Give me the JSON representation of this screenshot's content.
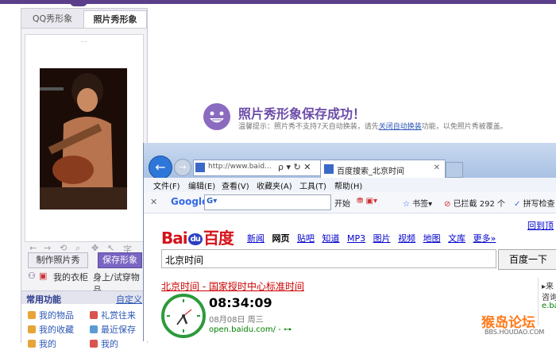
{
  "left_panel": {
    "tabs": [
      "QQ秀形象",
      "照片秀形象"
    ],
    "photo_label": "...",
    "make_button": "制作照片秀",
    "save_button": "保存形象",
    "links": [
      "我的衣柜",
      "身上/试穿物品"
    ],
    "section_title": "常用功能",
    "section_custom": "自定义",
    "functions": [
      "我的物品",
      "礼赏往来",
      "我的收藏",
      "最近保存",
      "我的",
      "我的"
    ]
  },
  "success": {
    "title": "照片秀形象保存成功！",
    "tip_before": "温馨提示：照片秀不支持7天自动换装，请先",
    "tip_link": "关闭自动换装",
    "tip_after": "功能，以免照片秀被覆盖。"
  },
  "browser": {
    "address": "http://www.baid...",
    "address_controls": "ρ ▾ ↻ ✕",
    "tab_title": "百度搜索_北京时间",
    "menus": [
      "文件(F)",
      "编辑(E)",
      "查看(V)",
      "收藏夹(A)",
      "工具(T)",
      "帮助(H)"
    ],
    "google_logo": "Google",
    "google_box_prefix": "G▾",
    "toolbar_items": [
      "开始",
      "书签▾",
      "已拦截 292 个",
      "拼写检查"
    ]
  },
  "baidu": {
    "logo_left": "Bai",
    "logo_du": "du",
    "logo_right": "百度",
    "nav": [
      "新闻",
      "网页",
      "贴吧",
      "知道",
      "MP3",
      "图片",
      "视频",
      "地图",
      "文库",
      "更多»"
    ],
    "login": "回到顶",
    "query": "北京时间",
    "search_button": "百度一下",
    "result": {
      "title_main": "北京时间",
      "title_rest": " - 国家授时中心标准时间",
      "time": "08:34:09",
      "date": "08月08日   周三",
      "url": "open.baidu.com/ - ⊶"
    },
    "side_ad": [
      "▸来",
      "咨询",
      "e.ba"
    ]
  },
  "watermark": {
    "main": "猴岛论坛",
    "sub": "BBS.HOUDAO.COM"
  },
  "colors": {
    "purple": "#6c4ca8",
    "baidu_red": "#d6121a",
    "link_blue": "#0000cc",
    "green": "#2c9a3a"
  }
}
